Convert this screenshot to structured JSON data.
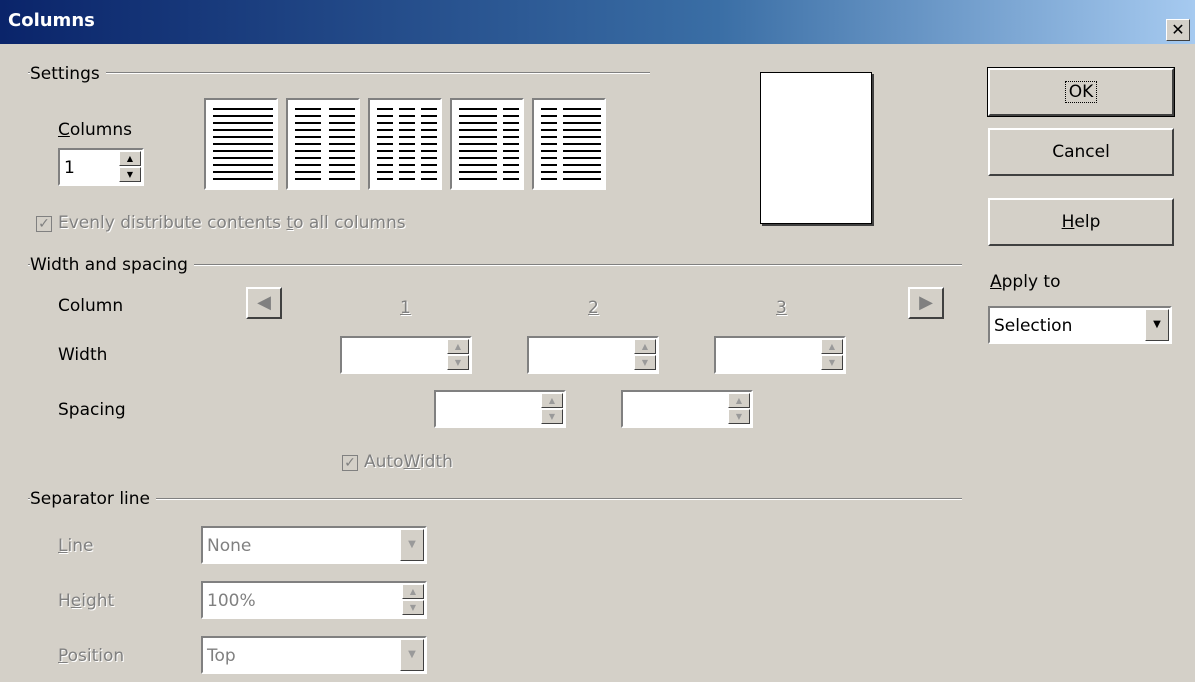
{
  "window": {
    "title": "Columns",
    "close_glyph": "✕"
  },
  "settings": {
    "group_label": "Settings",
    "columns_label_prefix": "",
    "columns_label_u": "C",
    "columns_label_rest": "olumns",
    "columns_value": "1",
    "presets": [
      "one-column",
      "two-columns",
      "three-columns",
      "left-wide",
      "right-wide"
    ],
    "evenly_checked": true,
    "evenly_label_a": "Evenly distribute contents ",
    "evenly_label_u": "t",
    "evenly_label_b": "o all columns"
  },
  "width_spacing": {
    "group_label": "Width and spacing",
    "column_label": "Column",
    "width_label": "Width",
    "spacing_label": "Spacing",
    "column_numbers": [
      "1",
      "2",
      "3"
    ],
    "left_arrow_icon": "arrow-left-icon",
    "right_arrow_icon": "arrow-right-icon",
    "autowidth_checked": true,
    "autowidth_a": "Auto",
    "autowidth_u": "W",
    "autowidth_b": "idth"
  },
  "separator": {
    "group_label": "Separator line",
    "line_u": "L",
    "line_rest": "ine",
    "height_a": "H",
    "height_u": "e",
    "height_b": "ight",
    "position_u": "P",
    "position_rest": "osition",
    "line_value": "None",
    "height_value": "100%",
    "position_value": "Top"
  },
  "buttons": {
    "ok": "OK",
    "cancel": "Cancel",
    "help_u": "H",
    "help_rest": "elp"
  },
  "apply_to": {
    "label_u": "A",
    "label_rest": "pply to",
    "value": "Selection"
  },
  "glyphs": {
    "check": "✓",
    "up": "▲",
    "down": "▼",
    "left": "◀",
    "right": "▶"
  }
}
